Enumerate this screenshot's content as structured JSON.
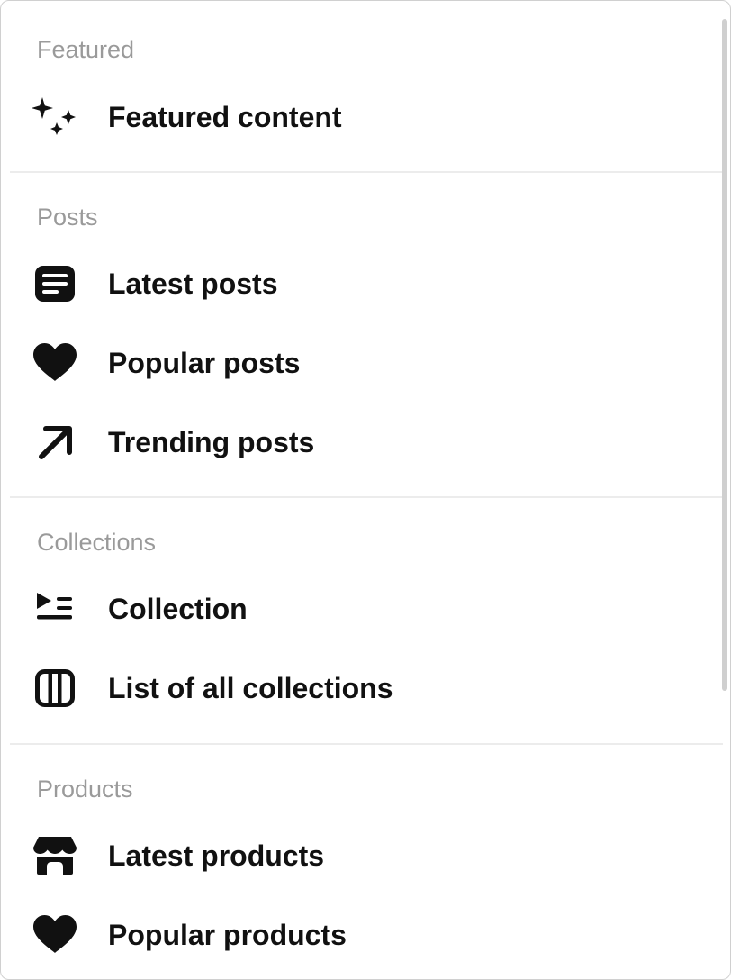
{
  "sections": {
    "featured": {
      "label": "Featured",
      "items": [
        {
          "label": "Featured content",
          "icon": "sparkles-icon"
        }
      ]
    },
    "posts": {
      "label": "Posts",
      "items": [
        {
          "label": "Latest posts",
          "icon": "document-icon"
        },
        {
          "label": "Popular posts",
          "icon": "heart-icon"
        },
        {
          "label": "Trending posts",
          "icon": "arrow-up-right-icon"
        }
      ]
    },
    "collections": {
      "label": "Collections",
      "items": [
        {
          "label": "Collection",
          "icon": "playlist-icon"
        },
        {
          "label": "List of all collections",
          "icon": "columns-icon"
        }
      ]
    },
    "products": {
      "label": "Products",
      "items": [
        {
          "label": "Latest products",
          "icon": "storefront-icon"
        },
        {
          "label": "Popular products",
          "icon": "heart-icon"
        }
      ]
    }
  }
}
